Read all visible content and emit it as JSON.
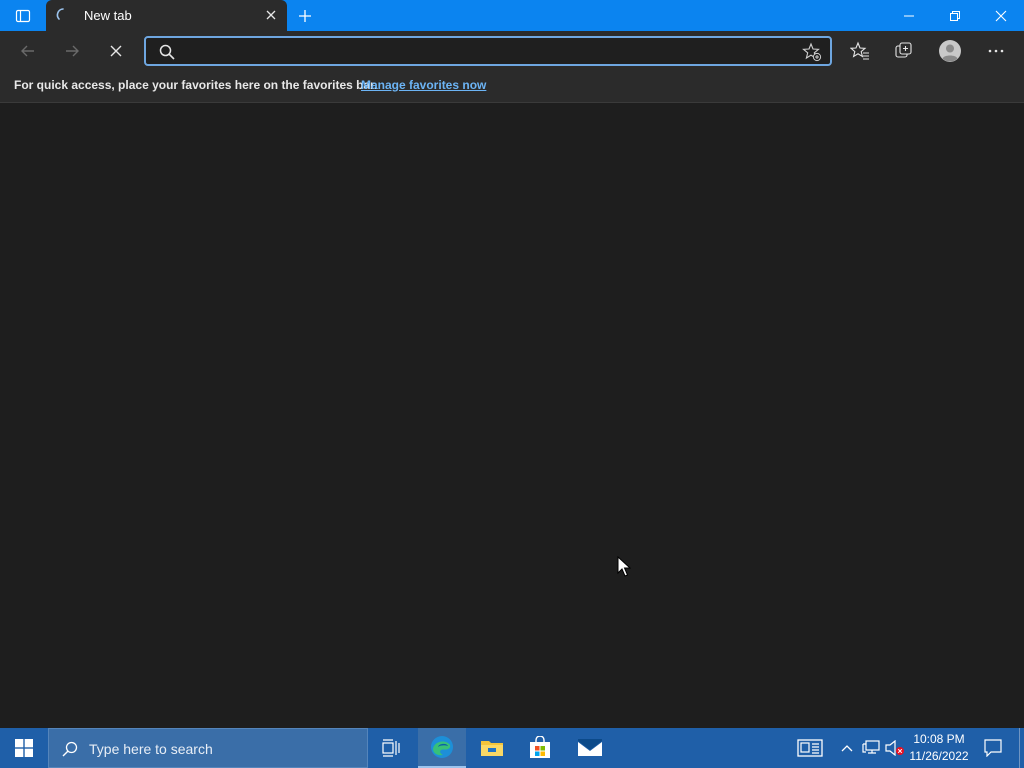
{
  "browser": {
    "tab": {
      "title": "New tab"
    },
    "address_bar": {
      "value": "",
      "placeholder": ""
    },
    "favorites_bar": {
      "message": "For quick access, place your favorites here on the favorites bar.",
      "link": "Manage favorites now"
    }
  },
  "taskbar": {
    "search_placeholder": "Type here to search",
    "clock": {
      "time": "10:08 PM",
      "date": "11/26/2022"
    }
  },
  "colors": {
    "titlebar": "#0b84f0",
    "toolbar": "#2b2b2b",
    "content": "#1e1e1e",
    "taskbar": "#1f5fa8",
    "link": "#6cb4f5"
  },
  "icons": [
    "tab-actions-icon",
    "loading-icon",
    "close-icon",
    "plus-icon",
    "minimize-icon",
    "restore-icon",
    "close-window-icon",
    "back-icon",
    "forward-icon",
    "stop-icon",
    "search-icon",
    "add-favorite-icon",
    "favorites-icon",
    "collections-icon",
    "profile-icon",
    "more-icon",
    "windows-start-icon",
    "task-view-icon",
    "edge-icon",
    "file-explorer-icon",
    "store-icon",
    "mail-icon",
    "news-icon",
    "chevron-up-icon",
    "network-icon",
    "volume-muted-icon",
    "notification-icon",
    "mouse-cursor-icon"
  ]
}
